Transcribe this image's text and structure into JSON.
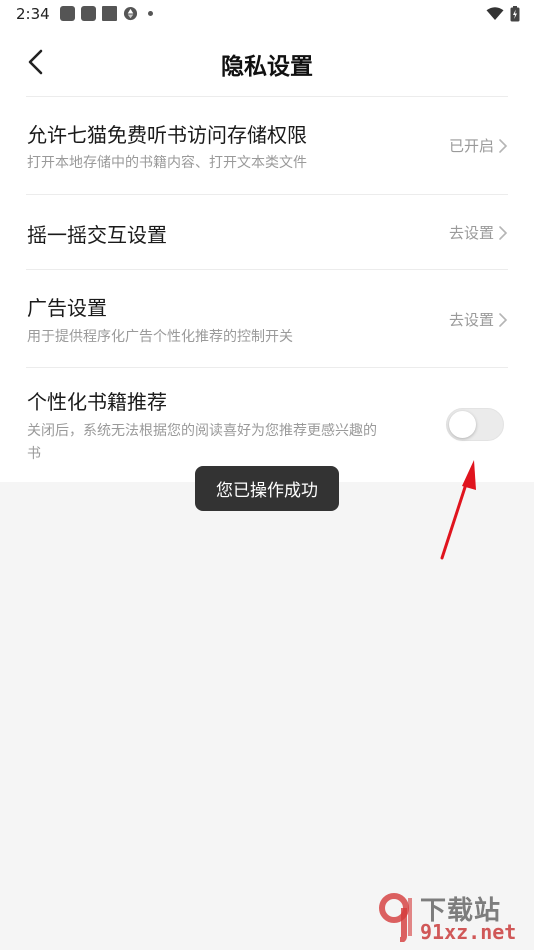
{
  "status_bar": {
    "time": "2:34"
  },
  "header": {
    "title": "隐私设置"
  },
  "settings": [
    {
      "title": "允许七猫免费听书访问存储权限",
      "subtitle": "打开本地存储中的书籍内容、打开文本类文件",
      "value": "已开启"
    },
    {
      "title": "摇一摇交互设置",
      "value": "去设置"
    },
    {
      "title": "广告设置",
      "subtitle": "用于提供程序化广告个性化推荐的控制开关",
      "value": "去设置"
    },
    {
      "title": "个性化书籍推荐",
      "subtitle_line1": "关闭后，系统无法根据您的阅读喜好为您推荐更感兴趣的",
      "subtitle_line2": "书",
      "enabled": false
    }
  ],
  "toast": {
    "text": "您已操作成功"
  },
  "watermark": {
    "top": "下载站",
    "bottom": "91xz.net"
  },
  "colors": {
    "arrow": "#e0141e",
    "toggle_off": "#ebebeb",
    "toast_bg": "#333333"
  }
}
